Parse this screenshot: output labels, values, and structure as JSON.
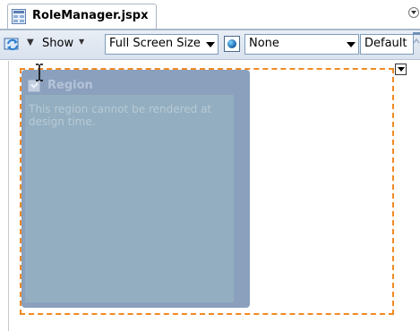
{
  "tab": {
    "icon": "jspx-file-icon",
    "title": "RoleManager.jspx",
    "menu_icon": "tab-list-dropdown-icon"
  },
  "toolbar": {
    "refresh_icon": "refresh-icon",
    "show_label": "Show",
    "screen_size": "Full Screen Size",
    "skin_icon": "globe-icon",
    "skin_value": "None",
    "default_label": "Default"
  },
  "canvas": {
    "menu_icon": "component-menu-icon",
    "cursor_icon": "text-cursor-icon",
    "region": {
      "title": "Region",
      "message": "This region cannot be rendered at design time."
    }
  },
  "colors": {
    "selection_border": "#f08a24",
    "region_bg": "#8aa0bd",
    "region_inner": "#93aec0"
  }
}
